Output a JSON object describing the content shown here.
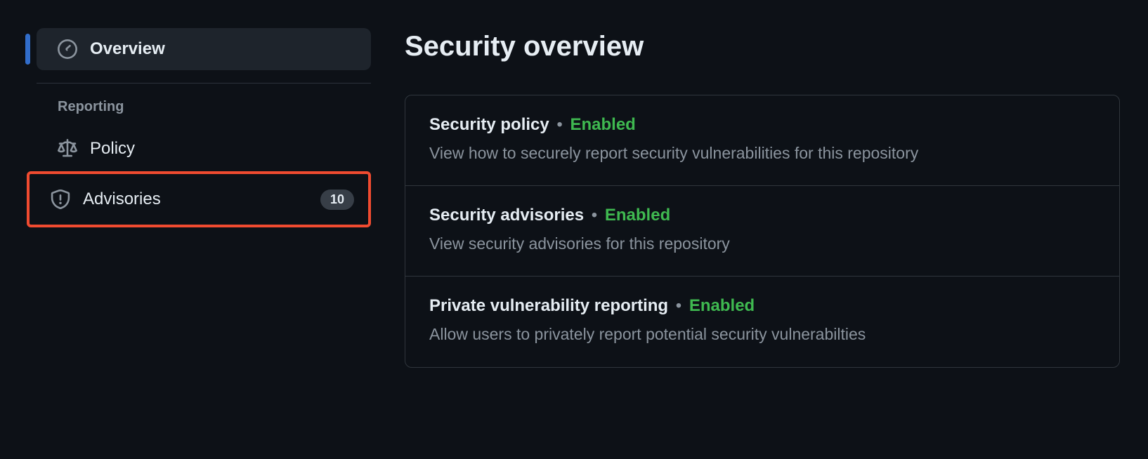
{
  "sidebar": {
    "overview": {
      "label": "Overview"
    },
    "reporting_heading": "Reporting",
    "policy": {
      "label": "Policy"
    },
    "advisories": {
      "label": "Advisories",
      "count": "10"
    }
  },
  "main": {
    "title": "Security overview",
    "cards": [
      {
        "title": "Security policy",
        "status": "Enabled",
        "desc": "View how to securely report security vulnerabilities for this repository"
      },
      {
        "title": "Security advisories",
        "status": "Enabled",
        "desc": "View security advisories for this repository"
      },
      {
        "title": "Private vulnerability reporting",
        "status": "Enabled",
        "desc": "Allow users to privately report potential security vulnerabilties"
      }
    ]
  },
  "colors": {
    "bg": "#0d1117",
    "text": "#e6edf3",
    "muted": "#8b949e",
    "border": "#30363d",
    "accent": "#316dca",
    "success": "#3fb950",
    "highlight": "#f04b30",
    "hover": "#1e242c",
    "counter_bg": "#373e47"
  }
}
